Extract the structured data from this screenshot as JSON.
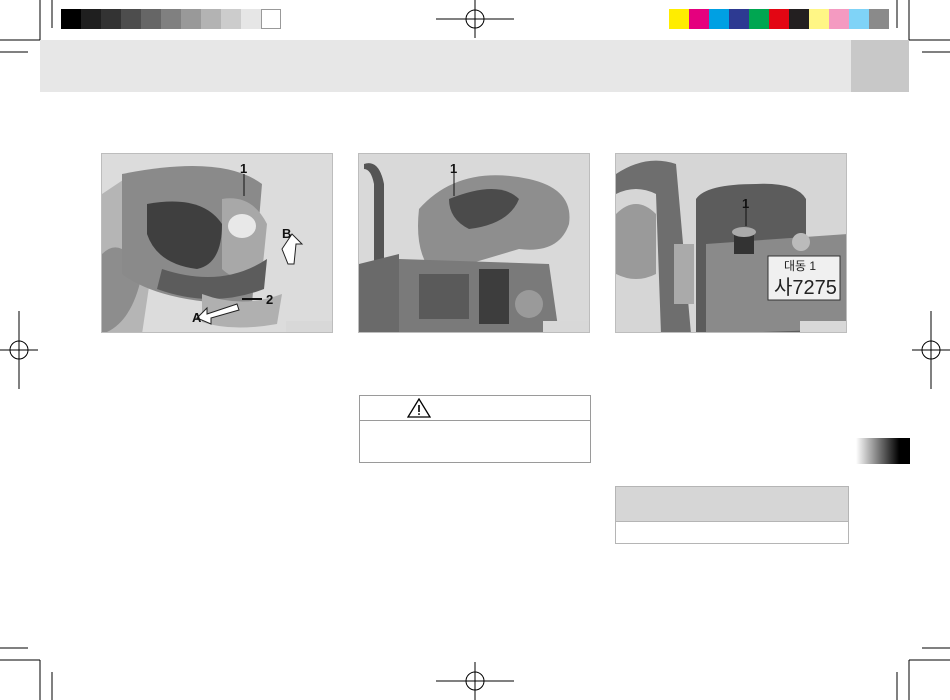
{
  "color_bar": {
    "gray_steps": [
      "#000000",
      "#1f1f1f",
      "#333333",
      "#4d4d4d",
      "#666666",
      "#808080",
      "#999999",
      "#b3b3b3",
      "#cccccc",
      "#e6e6e6",
      "#ffffff"
    ],
    "process_colors": [
      "#ffed00",
      "#e5007e",
      "#00a0e3",
      "#2d3a92",
      "#00a651",
      "#e30613",
      "#231f20",
      "#fff685",
      "#f49ac1",
      "#7fd3f7",
      "#8a8a8a"
    ]
  },
  "figure1": {
    "callout_1": "1",
    "callout_2": "2",
    "arrow_a": "A",
    "arrow_b": "B"
  },
  "figure2": {
    "callout_1": "1"
  },
  "figure3": {
    "callout_1": "1",
    "plate_top": "대동 1",
    "plate_bottom": "사7275"
  },
  "warning": {
    "icon": "warning-triangle-icon"
  }
}
